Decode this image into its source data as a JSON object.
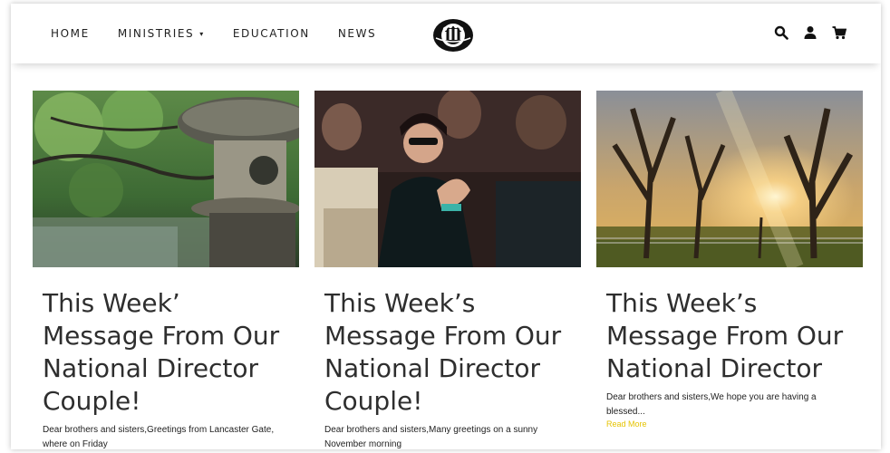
{
  "nav": {
    "links": [
      "HOME",
      "MINISTRIES",
      "EDUCATION",
      "NEWS"
    ],
    "ministries_caret": "▾",
    "icons": [
      "search-icon",
      "user-icon",
      "cart-icon"
    ]
  },
  "posts": [
    {
      "title": "This Week’ Message From Our National Director Couple!",
      "excerpt": "Dear brothers and sisters,Greetings from Lancaster Gate, where on Friday",
      "image": "garden-stone-lantern-photo"
    },
    {
      "title": "This Week’s Message From Our National Director Couple!",
      "excerpt": "Dear brothers and sisters,Many greetings on a sunny November morning",
      "image": "woman-applauding-photo"
    },
    {
      "title": "This Week’s Message From Our National Director",
      "excerpt": "Dear brothers and sisters,We hope you are having a blessed...",
      "read_more": "Read More",
      "image": "sunrise-trees-photo"
    }
  ],
  "colors": {
    "text": "#2e2e2e",
    "read_more": "#e5c300",
    "nav_text": "#222222"
  }
}
